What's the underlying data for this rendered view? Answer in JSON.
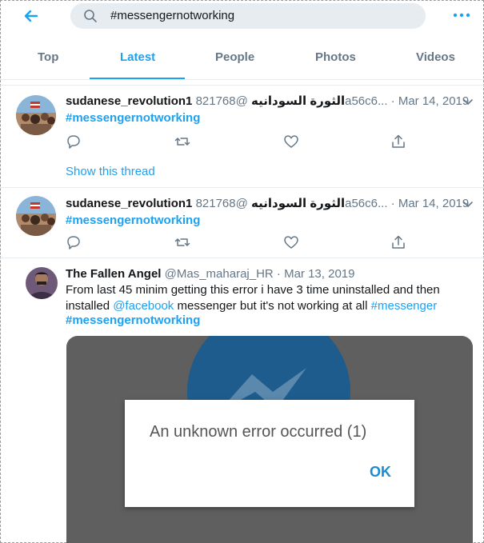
{
  "header": {
    "search_query": "#messengernotworking",
    "back_icon": "back-arrow-icon",
    "more_icon": "more-options-icon"
  },
  "tabs": [
    {
      "label": "Top",
      "active": false
    },
    {
      "label": "Latest",
      "active": true
    },
    {
      "label": "People",
      "active": false
    },
    {
      "label": "Photos",
      "active": false
    },
    {
      "label": "Videos",
      "active": false
    }
  ],
  "tweets": [
    {
      "name": "sudanese_revolution1 الثورة السودانيه",
      "handle": "@821768a56c6...",
      "separator": "·",
      "date": "Mar 14, 2019",
      "hashtag": "#messengernotworking",
      "show_thread": "Show this thread"
    },
    {
      "name": "sudanese_revolution1 الثورة السودانيه",
      "handle": "@821768a56c6...",
      "separator": "·",
      "date": "Mar 14, 2019",
      "hashtag": "#messengernotworking"
    },
    {
      "name": "The Fallen Angel",
      "handle": "@Mas_maharaj_HR",
      "separator": "·",
      "date": "Mar 13, 2019",
      "text_line1": "From last 45 minim getting this error i have 3 time uninstalled and then",
      "text_line2_prefix": "installed ",
      "mention": "@facebook",
      "text_line2_suffix": " messenger but it's not working at all ",
      "hashtag_inline": "#messenger",
      "hashtag": "#messengernotworking",
      "media": {
        "error_message": "An unknown error occurred (1)",
        "ok_label": "OK"
      }
    }
  ],
  "colors": {
    "accent": "#1da1f2",
    "text": "#14171a",
    "muted": "#657786",
    "search_bg": "#e6ecf0"
  }
}
